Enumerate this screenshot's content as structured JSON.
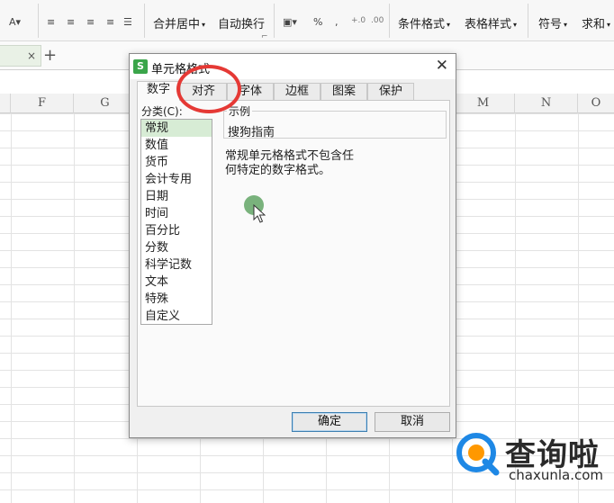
{
  "ribbon": {
    "merge_center": "合并居中",
    "wrap_text": "自动换行",
    "percent": "%",
    "comma": ",",
    "conditional_format": "条件格式",
    "table_style": "表格样式",
    "symbol": "符号",
    "sum": "求和"
  },
  "sheet_tabs": {
    "close_glyph": "×",
    "add_glyph": "+"
  },
  "columns": [
    "F",
    "G",
    "M",
    "N",
    "O"
  ],
  "dialog": {
    "title": "单元格格式",
    "app_badge": "S",
    "close_glyph": "✕",
    "tabs": [
      "数字",
      "对齐",
      "字体",
      "边框",
      "图案",
      "保护"
    ],
    "active_tab_index": 0,
    "category_label": "分类(C):",
    "categories": [
      "常规",
      "数值",
      "货币",
      "会计专用",
      "日期",
      "时间",
      "百分比",
      "分数",
      "科学记数",
      "文本",
      "特殊",
      "自定义"
    ],
    "selected_category_index": 0,
    "sample_label": "示例",
    "sample_value": "搜狗指南",
    "description_line1": "常规单元格格式不包含任",
    "description_line2": "何特定的数字格式。",
    "ok_label": "确定",
    "cancel_label": "取消"
  },
  "watermark": {
    "name": "查询啦",
    "domain": "chaxunla.com"
  },
  "colors": {
    "accent_green": "#3aa54a",
    "selection_green": "#d7ecd5",
    "highlight_red": "#e53935",
    "cursor_green": "#6aaa6e"
  }
}
